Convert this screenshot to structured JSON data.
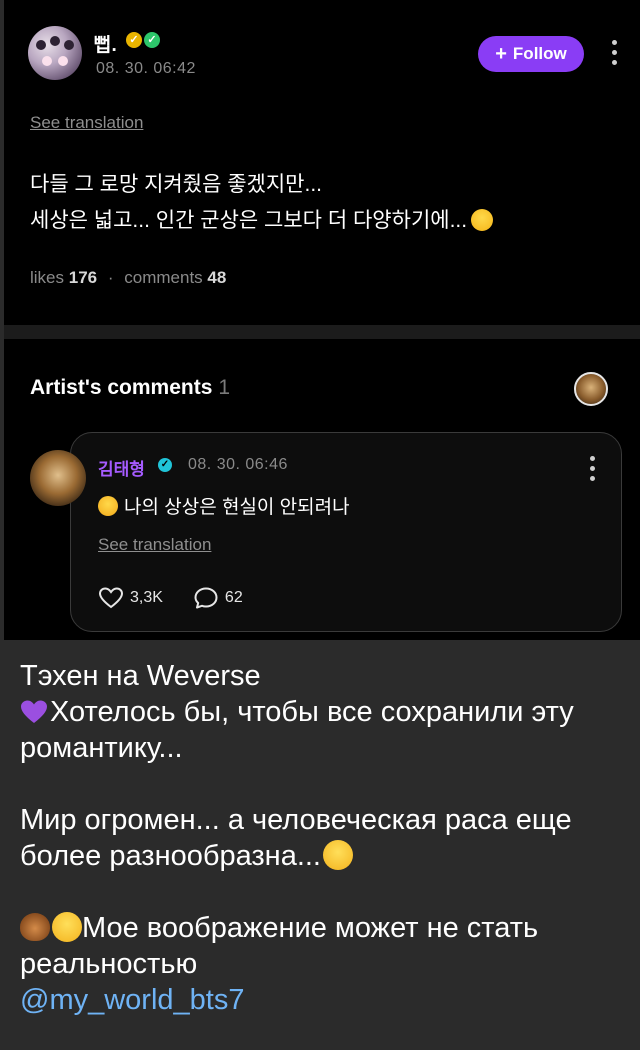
{
  "post": {
    "author": "뻡.",
    "timestamp": "08. 30. 06:42",
    "follow_label": "Follow",
    "see_translation": "See translation",
    "line1": "다들 그 로망 지켜줬음 좋겠지만...",
    "line2": "세상은 넓고... 인간 군상은 그보다 더 다양하기에...",
    "likes_label": "likes",
    "likes_value": "176",
    "comments_label": "comments",
    "comments_value": "48"
  },
  "artist_comments": {
    "title": "Artist's comments",
    "count": "1",
    "comment": {
      "author": "김태형",
      "timestamp": "08. 30. 06:46",
      "text": "나의 상상은 현실이 안되려나",
      "see_translation": "See translation",
      "likes": "3,3K",
      "replies": "62"
    }
  },
  "caption": {
    "line1": "Тэхен на Weverse",
    "line2": "Хотелось бы, чтобы все сохранили эту романтику...",
    "line3": "Мир огромен... а человеческая раса еще более разнообразна...",
    "line4": "Мое воображение может не стать реальностью",
    "handle": "@my_world_bts7"
  },
  "colors": {
    "accent_purple": "#8a3df5",
    "artist_name": "#a55bff",
    "verified": "#20c4d8",
    "link": "#6fb3f5"
  },
  "icons": [
    "more-vertical-icon",
    "plus-icon",
    "heart-outline-icon",
    "comment-bubble-icon",
    "verified-icon"
  ]
}
